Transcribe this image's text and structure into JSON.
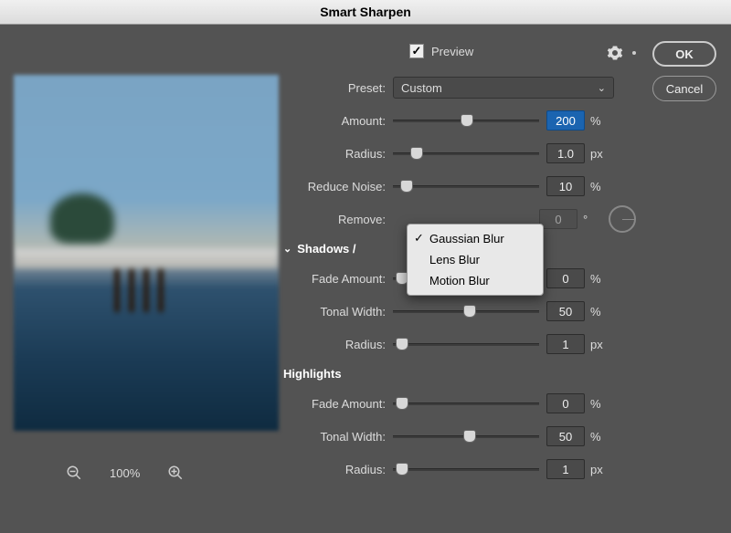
{
  "title": "Smart Sharpen",
  "buttons": {
    "ok": "OK",
    "cancel": "Cancel"
  },
  "preview": {
    "label": "Preview",
    "checked": true
  },
  "gear_icon": "settings-icon",
  "preset": {
    "label": "Preset:",
    "value": "Custom"
  },
  "amount": {
    "label": "Amount:",
    "value": "200",
    "unit": "%",
    "pos": 46
  },
  "radius": {
    "label": "Radius:",
    "value": "1.0",
    "unit": "px",
    "pos": 12
  },
  "reduce_noise": {
    "label": "Reduce Noise:",
    "value": "10",
    "unit": "%",
    "pos": 5
  },
  "remove": {
    "label": "Remove:",
    "selected": "Gaussian Blur",
    "options": [
      "Gaussian Blur",
      "Lens Blur",
      "Motion Blur"
    ],
    "angle_value": "0",
    "angle_unit": "°"
  },
  "shadows_header": "Shadows /",
  "highlights_header": "Highlights",
  "shadows": {
    "fade": {
      "label": "Fade Amount:",
      "value": "0",
      "unit": "%",
      "pos": 2
    },
    "tonal": {
      "label": "Tonal Width:",
      "value": "50",
      "unit": "%",
      "pos": 48
    },
    "radius": {
      "label": "Radius:",
      "value": "1",
      "unit": "px",
      "pos": 2
    }
  },
  "highlights": {
    "fade": {
      "label": "Fade Amount:",
      "value": "0",
      "unit": "%",
      "pos": 2
    },
    "tonal": {
      "label": "Tonal Width:",
      "value": "50",
      "unit": "%",
      "pos": 48
    },
    "radius": {
      "label": "Radius:",
      "value": "1",
      "unit": "px",
      "pos": 2
    }
  },
  "zoom": {
    "level": "100%"
  }
}
